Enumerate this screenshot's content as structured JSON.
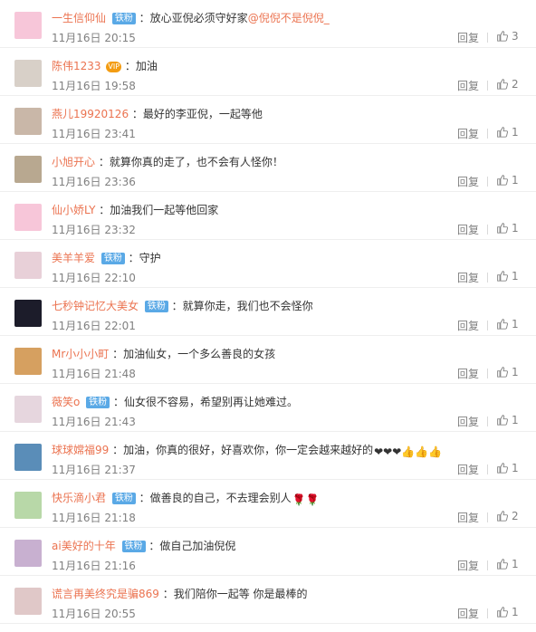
{
  "comments": [
    {
      "username": "一生信仰仙",
      "badge": "铁粉",
      "vip": "",
      "text": "：放心亚倪必须守好家",
      "mention": "@倪倪不是倪倪_",
      "emojis": "",
      "time": "11月16日 20:15",
      "reply": "回复",
      "likes": "3"
    },
    {
      "username": "陈伟1233",
      "badge": "",
      "vip": "VIP",
      "text": "：加油",
      "mention": "",
      "emojis": "",
      "time": "11月16日 19:58",
      "reply": "回复",
      "likes": "2"
    },
    {
      "username": "燕儿19920126",
      "badge": "",
      "vip": "",
      "text": "：最好的李亚倪，一起等他",
      "mention": "",
      "emojis": "",
      "time": "11月16日 23:41",
      "reply": "回复",
      "likes": "1"
    },
    {
      "username": "小旭开心",
      "badge": "",
      "vip": "",
      "text": "：就算你真的走了，也不会有人怪你！",
      "mention": "",
      "emojis": "",
      "time": "11月16日 23:36",
      "reply": "回复",
      "likes": "1"
    },
    {
      "username": "仙小娇LY",
      "badge": "",
      "vip": "",
      "text": "：加油我们一起等他回家",
      "mention": "",
      "emojis": "",
      "time": "11月16日 23:32",
      "reply": "回复",
      "likes": "1"
    },
    {
      "username": "美羊羊爱",
      "badge": "铁粉",
      "vip": "",
      "text": "：守护",
      "mention": "",
      "emojis": "",
      "time": "11月16日 22:10",
      "reply": "回复",
      "likes": "1"
    },
    {
      "username": "七秒钟记忆大美女",
      "badge": "铁粉",
      "vip": "",
      "text": "：就算你走，我们也不会怪你",
      "mention": "",
      "emojis": "",
      "time": "11月16日 22:01",
      "reply": "回复",
      "likes": "1"
    },
    {
      "username": "Mr小小小町",
      "badge": "",
      "vip": "",
      "text": "：加油仙女，一个多么善良的女孩",
      "mention": "",
      "emojis": "",
      "time": "11月16日 21:48",
      "reply": "回复",
      "likes": "1"
    },
    {
      "username": "薇笑o",
      "badge": "铁粉",
      "vip": "",
      "text": "：仙女很不容易，希望别再让她难过。",
      "mention": "",
      "emojis": "",
      "time": "11月16日 21:43",
      "reply": "回复",
      "likes": "1"
    },
    {
      "username": "球球嫦福99",
      "badge": "",
      "vip": "",
      "text": "：加油，你真的很好，好喜欢你，你一定会越来越好的",
      "mention": "",
      "emojis": "❤❤❤👍👍👍",
      "time": "11月16日 21:37",
      "reply": "回复",
      "likes": "1"
    },
    {
      "username": "快乐滴小君",
      "badge": "铁粉",
      "vip": "",
      "text": "：做善良的自己，不去理会别人",
      "mention": "",
      "emojis": "🌹🌹",
      "time": "11月16日 21:18",
      "reply": "回复",
      "likes": "2"
    },
    {
      "username": "ai美好的十年",
      "badge": "铁粉",
      "vip": "",
      "text": "：做自己加油倪倪",
      "mention": "",
      "emojis": "",
      "time": "11月16日 21:16",
      "reply": "回复",
      "likes": "1"
    },
    {
      "username": "谎言再美终究是骗869",
      "badge": "",
      "vip": "",
      "text": "：我们陪你一起等 你是最棒的",
      "mention": "",
      "emojis": "",
      "time": "11月16日 20:55",
      "reply": "回复",
      "likes": "1"
    }
  ],
  "avatar_colors": [
    "#f7c6d9",
    "#d8d0c8",
    "#c9b7a8",
    "#b8a890",
    "#f7c6d9",
    "#e8d0d8",
    "#1c1c2a",
    "#d6a060",
    "#e6d6de",
    "#5a8db8",
    "#b8d8a8",
    "#c8b0d0",
    "#e0c8c8"
  ],
  "icons": {
    "like": "thumb-up-icon"
  }
}
